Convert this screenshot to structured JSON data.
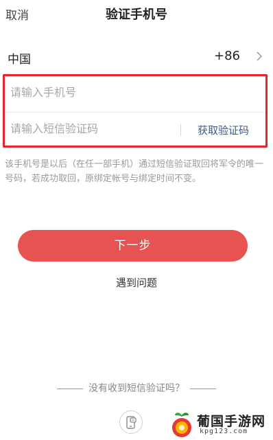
{
  "header": {
    "cancel_label": "取消",
    "title": "验证手机号"
  },
  "country": {
    "name": "中国",
    "code": "+86",
    "chevron_icon": "chevron-right-icon"
  },
  "form": {
    "phone_placeholder": "请输入手机号",
    "code_placeholder": "请输入短信验证码",
    "get_code_label": "获取验证码",
    "highlight_color": "#e5242c"
  },
  "notice": "该手机号是以后（在任一部手机）通过短信验证取回将军令的唯一号码，若成功取回，原绑定帐号与绑定时间不变。",
  "actions": {
    "next_label": "下一步",
    "next_color": "#e65352",
    "problem_label": "遇到问题"
  },
  "footer": {
    "no_sms_label": "没有收到短信验证吗？",
    "help_icon": "phone-chat-icon"
  },
  "watermark": {
    "title": "葡国手游网",
    "subtitle": "kpg123.com"
  }
}
